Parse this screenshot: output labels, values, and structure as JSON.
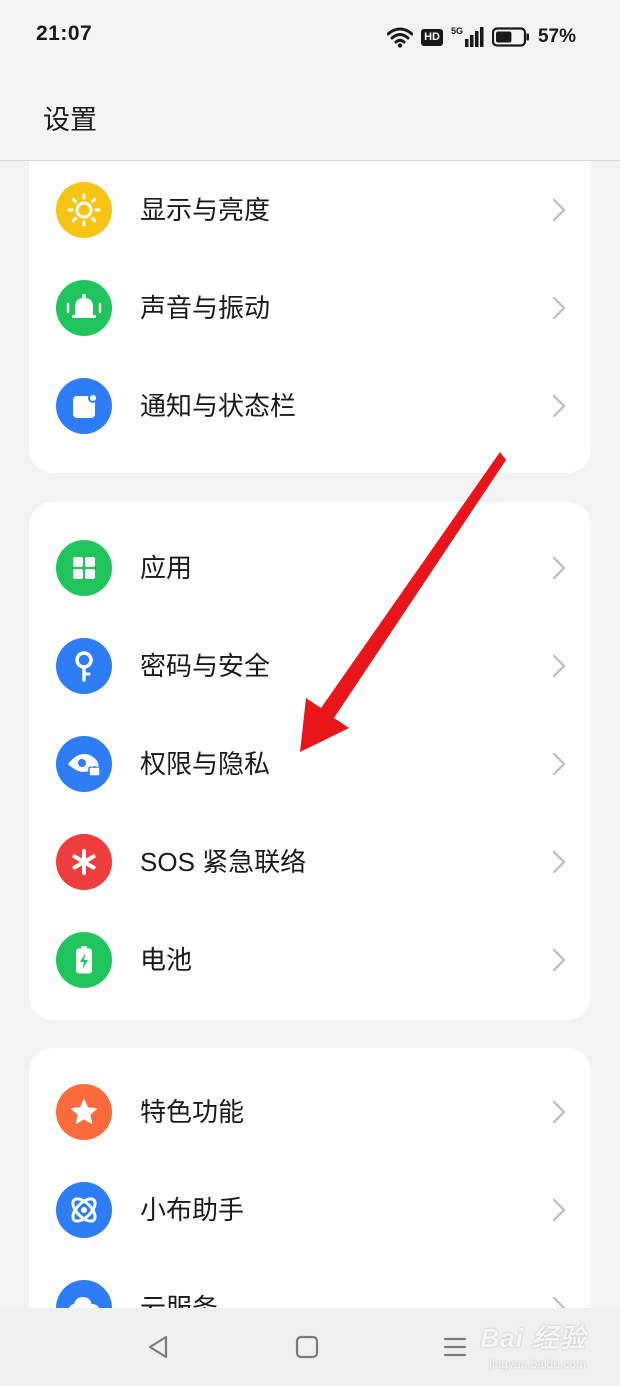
{
  "status_bar": {
    "time": "21:07",
    "hd": "HD",
    "network": "5G",
    "battery_percent": "57%",
    "battery_level": 0.57,
    "icons": [
      "wifi-icon",
      "hd-icon",
      "5g-signal-icon",
      "battery-icon"
    ]
  },
  "header": {
    "title": "设置"
  },
  "groups": [
    {
      "items": [
        {
          "label": "显示与亮度",
          "icon": "sun-icon",
          "color": "#f6c415"
        },
        {
          "label": "声音与振动",
          "icon": "bell-icon",
          "color": "#1fc45c"
        },
        {
          "label": "通知与状态栏",
          "icon": "notification-icon",
          "color": "#2e7cf6"
        }
      ]
    },
    {
      "items": [
        {
          "label": "应用",
          "icon": "apps-grid-icon",
          "color": "#1fc45c"
        },
        {
          "label": "密码与安全",
          "icon": "key-icon",
          "color": "#2e7cf6"
        },
        {
          "label": "权限与隐私",
          "icon": "privacy-eye-icon",
          "color": "#2e7cf6"
        },
        {
          "label": "SOS 紧急联络",
          "icon": "sos-asterisk-icon",
          "color": "#ef3c3c"
        },
        {
          "label": "电池",
          "icon": "battery-charging-icon",
          "color": "#1fc45c"
        }
      ]
    },
    {
      "items": [
        {
          "label": "特色功能",
          "icon": "star-icon",
          "color": "#fb6a3b"
        },
        {
          "label": "小布助手",
          "icon": "assistant-orbit-icon",
          "color": "#2e7cf6"
        },
        {
          "label": "云服务",
          "icon": "cloud-icon",
          "color": "#2e7cf6"
        }
      ]
    }
  ],
  "annotation": {
    "arrow_color": "#e8151b",
    "points_to": "权限与隐私"
  },
  "nav_bar": {
    "buttons": [
      "back-icon",
      "home-icon",
      "recents-icon"
    ]
  },
  "watermark": {
    "brand": "Bai 经验",
    "url": "jingyan.baidu.com"
  }
}
